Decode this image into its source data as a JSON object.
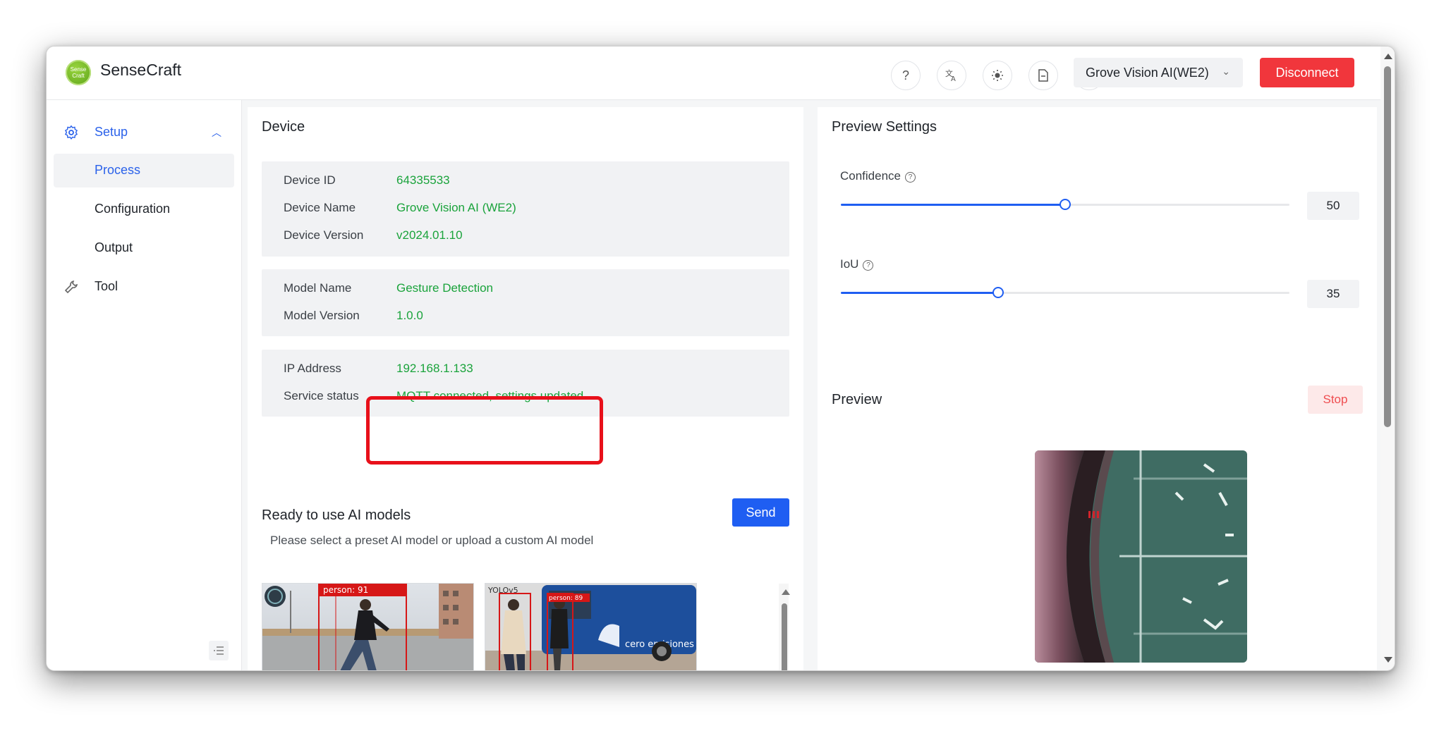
{
  "app": {
    "brand": "SenseCraft",
    "logo_top": "Sense",
    "logo_bottom": "Craft"
  },
  "header": {
    "device_select": "Grove Vision AI(WE2)",
    "disconnect_label": "Disconnect"
  },
  "sidebar": {
    "setup": "Setup",
    "process": "Process",
    "configuration": "Configuration",
    "output": "Output",
    "tool": "Tool"
  },
  "device": {
    "title": "Device",
    "id_label": "Device ID",
    "id_value": "64335533",
    "name_label": "Device Name",
    "name_value": "Grove Vision AI (WE2)",
    "version_label": "Device Version",
    "version_value": "v2024.01.10",
    "model_name_label": "Model Name",
    "model_name_value": "Gesture Detection",
    "model_version_label": "Model Version",
    "model_version_value": "1.0.0",
    "ip_label": "IP Address",
    "ip_value": "192.168.1.133",
    "service_label": "Service status",
    "service_value": "MQTT connected, settings updated"
  },
  "models": {
    "title": "Ready to use AI models",
    "subtitle": "Please select a preset AI model or upload a custom AI model",
    "send_label": "Send",
    "thumb1_tag": "person: 91",
    "thumb2_brand": "YOLOv5",
    "thumb2_tag": "person: 89",
    "thumb2_bus_text": "cero emisiones"
  },
  "preview_settings": {
    "title": "Preview Settings",
    "confidence_label": "Confidence",
    "confidence_value": "50",
    "iou_label": "IoU",
    "iou_value": "35"
  },
  "preview": {
    "title": "Preview",
    "stop_label": "Stop"
  },
  "colors": {
    "accent": "#1f5ef2",
    "success": "#1aa33b",
    "danger": "#f1363c",
    "highlight": "#e8101a"
  }
}
